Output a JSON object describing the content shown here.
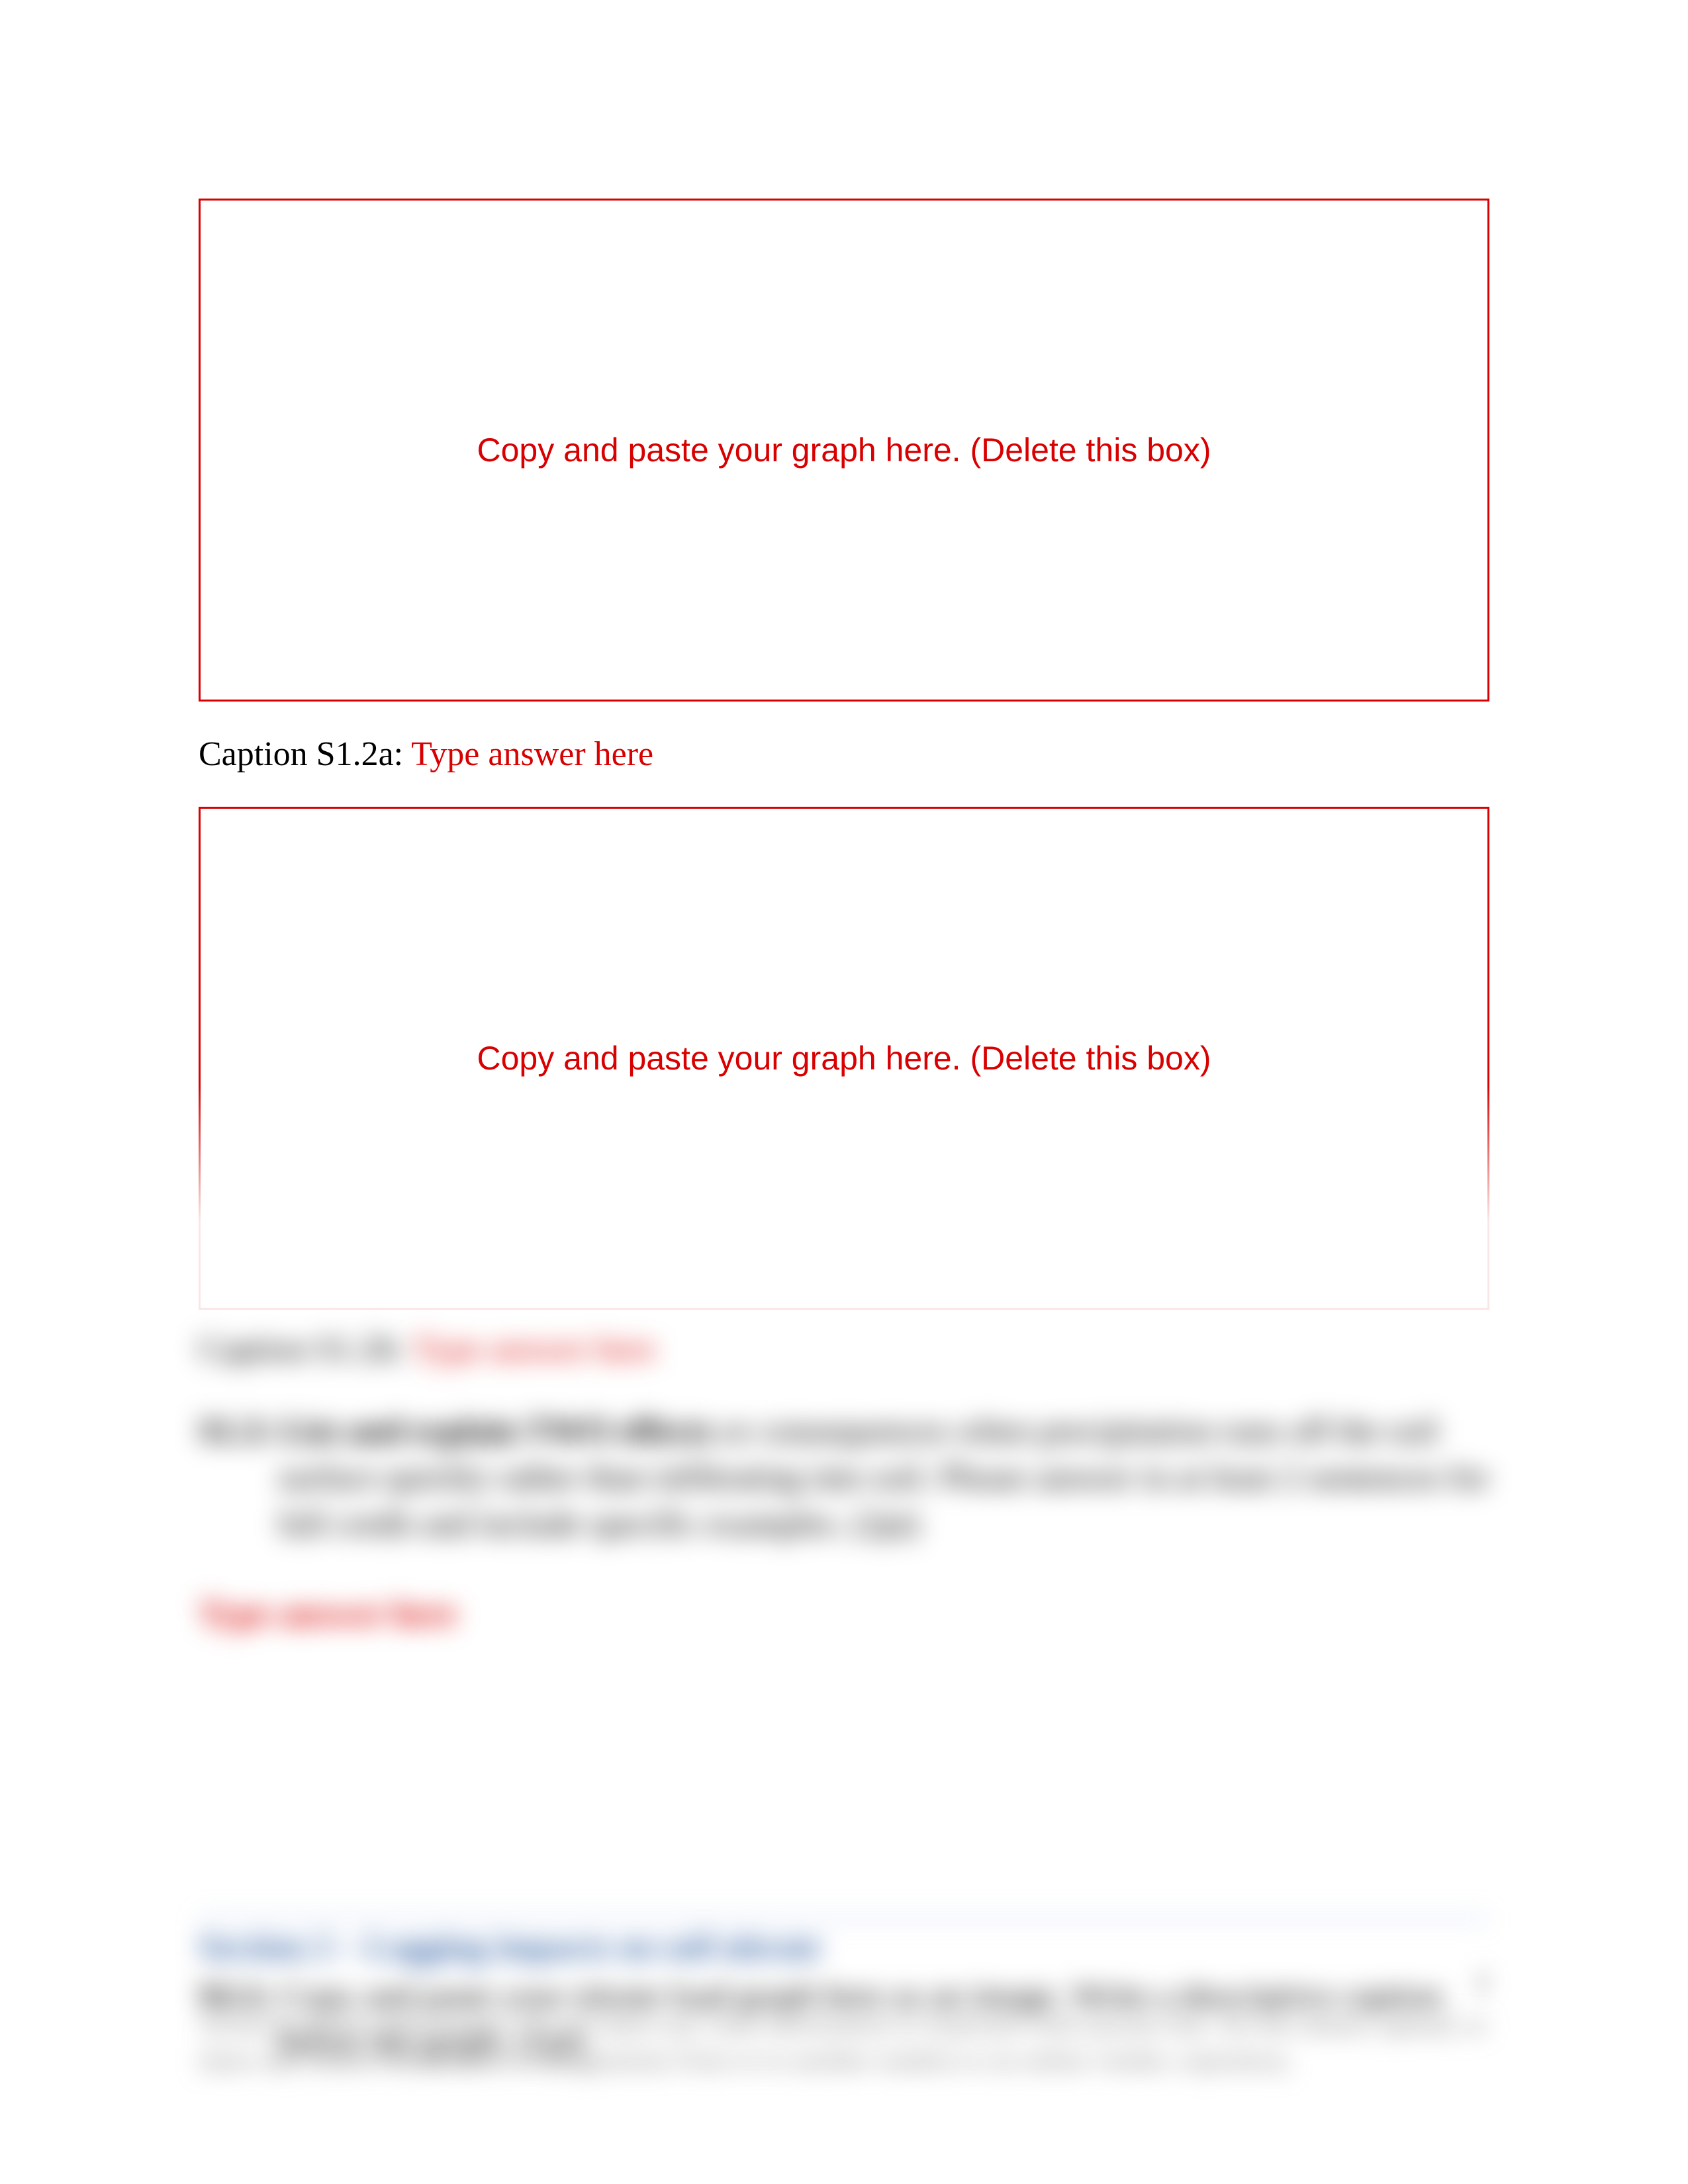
{
  "graph_box_1": {
    "placeholder": "Copy and paste your graph here. (Delete this box)"
  },
  "caption_1": {
    "label": "Caption S1.2a: ",
    "answer": "Type answer here"
  },
  "graph_box_2": {
    "placeholder": "Copy and paste your graph here. (Delete this box)"
  },
  "caption_2": {
    "label": "Caption S1.2b: ",
    "answer": "Type answer here"
  },
  "question_s1_3": {
    "label": "S1.3: ",
    "bold_lead": "List and explain TWO effects",
    "rest": " or consequences when precipitation runs off the soil surface quickly rather than infiltrating into soil. Please answer in at least 2 sentences for full credit and include specific examples. (2pt)"
  },
  "answer_placeholder": "Type answer here",
  "section2": {
    "title": "Section 2 – Logging impacts on soil nitrate",
    "s2_1": {
      "label": "S2.1: ",
      "text": "Copy and paste your nitrate load graph here as an image. Write a descriptive caption below the graph. (1pt)"
    }
  },
  "footer": "Avoid Academic Misconduct.  Do not share any class information or materials with anyone else. Do not obtain, upload, or share any course information or assignments from or to another student or an online vendor, repository,",
  "page_number": "2"
}
